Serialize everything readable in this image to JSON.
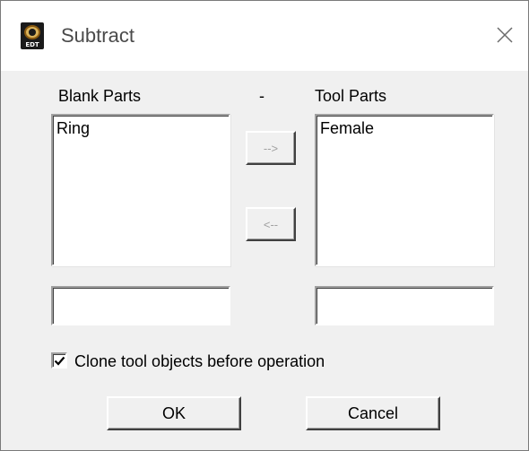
{
  "window": {
    "title": "Subtract",
    "icon": "edt-app-icon",
    "icon_text": "EDT"
  },
  "labels": {
    "blank_parts": "Blank Parts",
    "separator": "-",
    "tool_parts": "Tool Parts"
  },
  "blank_list": {
    "items": [
      "Ring"
    ]
  },
  "tool_list": {
    "items": [
      "Female"
    ]
  },
  "transfer": {
    "move_right": "-->",
    "move_left": "<--"
  },
  "inputs": {
    "blank_name": "",
    "tool_name": ""
  },
  "options": {
    "clone_label": "Clone tool objects before operation",
    "clone_checked": true
  },
  "buttons": {
    "ok": "OK",
    "cancel": "Cancel"
  }
}
